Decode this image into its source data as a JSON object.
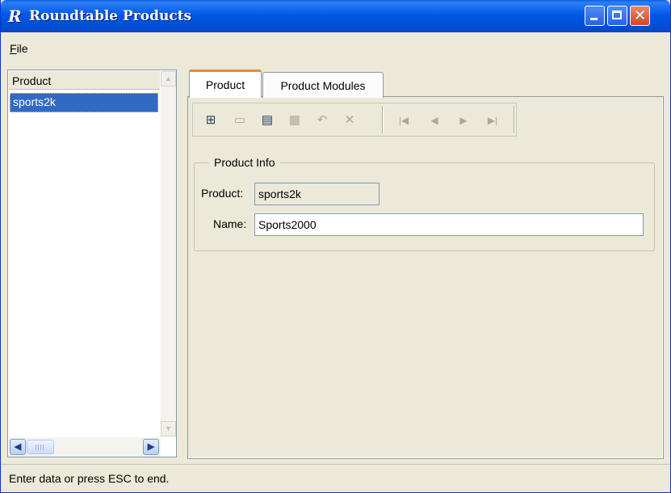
{
  "window": {
    "title": "Roundtable Products",
    "app_icon_letter": "R",
    "colors": {
      "titlebar": "#0058e6",
      "selection": "#316ac5",
      "tab_accent": "#e68b2c"
    }
  },
  "menu": {
    "file_label": "File"
  },
  "product_list": {
    "header": "Product",
    "rows": [
      "sports2k"
    ],
    "selected_index": 0
  },
  "tabs": [
    {
      "label": "Product",
      "active": true
    },
    {
      "label": "Product Modules",
      "active": false
    }
  ],
  "toolbar": {
    "buttons": [
      {
        "icon": "add-record-icon",
        "glyph": "⊞",
        "enabled": true
      },
      {
        "icon": "copy-record-icon",
        "glyph": "▭",
        "enabled": false
      },
      {
        "icon": "modify-record-icon",
        "glyph": "▤",
        "enabled": true
      },
      {
        "icon": "save-record-icon",
        "glyph": "▦",
        "enabled": false
      },
      {
        "icon": "undo-icon",
        "glyph": "↶",
        "enabled": false
      },
      {
        "icon": "delete-record-icon",
        "glyph": "✕",
        "enabled": false
      },
      {
        "icon": "first-record-icon",
        "glyph": "|◀",
        "enabled": false
      },
      {
        "icon": "previous-record-icon",
        "glyph": "◀",
        "enabled": false
      },
      {
        "icon": "next-record-icon",
        "glyph": "▶",
        "enabled": false
      },
      {
        "icon": "last-record-icon",
        "glyph": "▶|",
        "enabled": false
      }
    ]
  },
  "product_info": {
    "group_title": "Product Info",
    "product_label": "Product:",
    "product_value": "sports2k",
    "name_label": "Name:",
    "name_value": "Sports2000"
  },
  "status": {
    "text": "Enter data or press ESC to end."
  }
}
